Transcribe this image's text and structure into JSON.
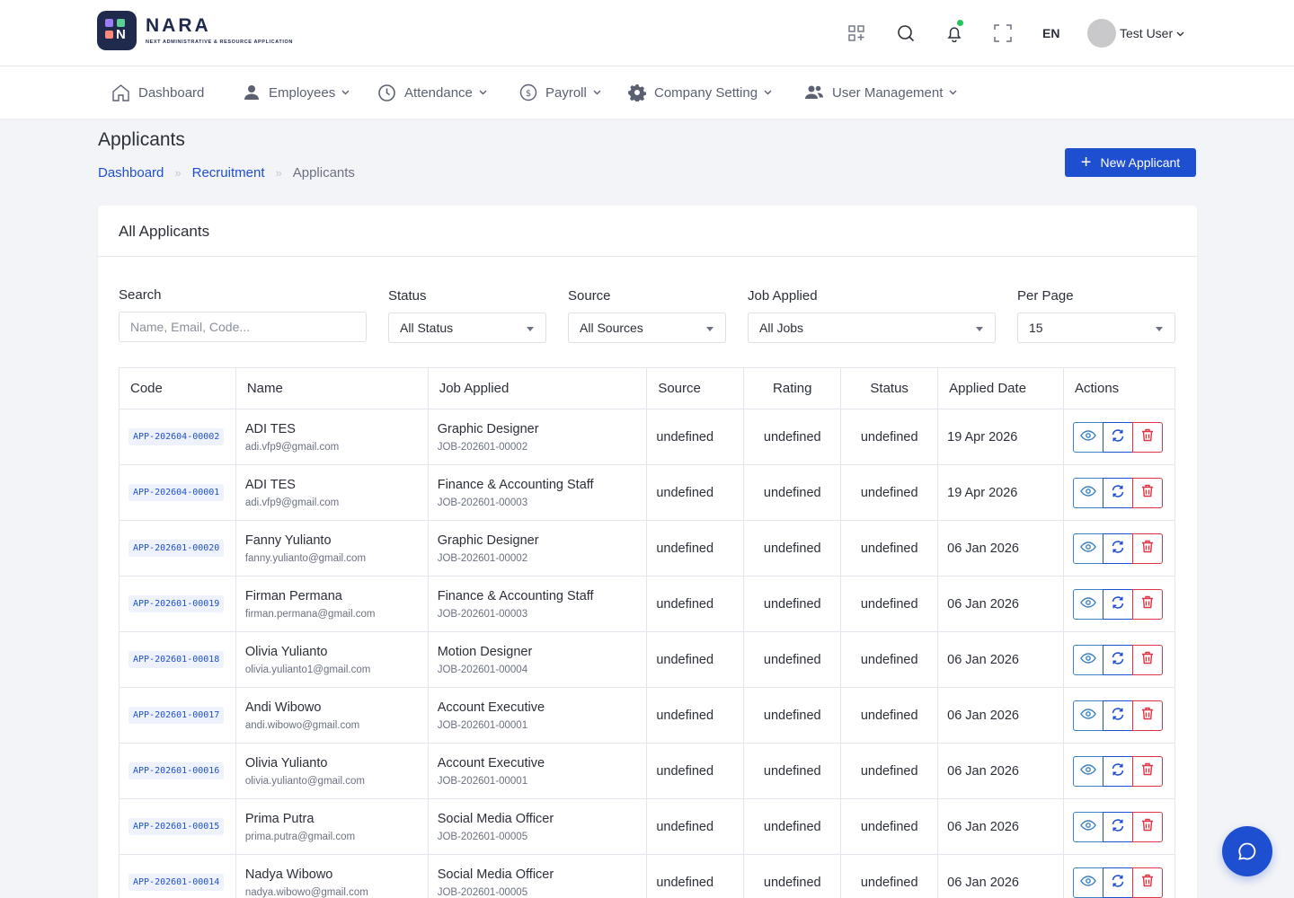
{
  "brand": {
    "name": "NARA",
    "tagline": "NEXT ADMINISTRATIVE & RESOURCE APPLICATION",
    "mark_letter": "N"
  },
  "header": {
    "language": "EN",
    "user_name": "Test User"
  },
  "nav": {
    "dashboard": "Dashboard",
    "employees": "Employees",
    "attendance": "Attendance",
    "payroll": "Payroll",
    "company_setting": "Company Setting",
    "user_management": "User Management"
  },
  "page": {
    "title": "Applicants",
    "breadcrumb": [
      "Dashboard",
      "Recruitment",
      "Applicants"
    ],
    "new_button": "New Applicant"
  },
  "card": {
    "title": "All Applicants",
    "filters": {
      "search_label": "Search",
      "search_placeholder": "Name, Email, Code...",
      "status_label": "Status",
      "status_value": "All Status",
      "source_label": "Source",
      "source_value": "All Sources",
      "job_label": "Job Applied",
      "job_value": "All Jobs",
      "perpage_label": "Per Page",
      "perpage_value": "15"
    },
    "columns": [
      "Code",
      "Name",
      "Job Applied",
      "Source",
      "Rating",
      "Status",
      "Applied Date",
      "Actions"
    ],
    "rows": [
      {
        "code": "APP-202604-00002",
        "name": "ADI TES",
        "email": "adi.vfp9@gmail.com",
        "job": "Graphic Designer",
        "job_code": "JOB-202601-00002",
        "source": "undefined",
        "rating": "undefined",
        "status": "undefined",
        "date": "19 Apr 2026"
      },
      {
        "code": "APP-202604-00001",
        "name": "ADI TES",
        "email": "adi.vfp9@gmail.com",
        "job": "Finance & Accounting Staff",
        "job_code": "JOB-202601-00003",
        "source": "undefined",
        "rating": "undefined",
        "status": "undefined",
        "date": "19 Apr 2026"
      },
      {
        "code": "APP-202601-00020",
        "name": "Fanny Yulianto",
        "email": "fanny.yulianto@gmail.com",
        "job": "Graphic Designer",
        "job_code": "JOB-202601-00002",
        "source": "undefined",
        "rating": "undefined",
        "status": "undefined",
        "date": "06 Jan 2026"
      },
      {
        "code": "APP-202601-00019",
        "name": "Firman Permana",
        "email": "firman.permana@gmail.com",
        "job": "Finance & Accounting Staff",
        "job_code": "JOB-202601-00003",
        "source": "undefined",
        "rating": "undefined",
        "status": "undefined",
        "date": "06 Jan 2026"
      },
      {
        "code": "APP-202601-00018",
        "name": "Olivia Yulianto",
        "email": "olivia.yulianto1@gmail.com",
        "job": "Motion Designer",
        "job_code": "JOB-202601-00004",
        "source": "undefined",
        "rating": "undefined",
        "status": "undefined",
        "date": "06 Jan 2026"
      },
      {
        "code": "APP-202601-00017",
        "name": "Andi Wibowo",
        "email": "andi.wibowo@gmail.com",
        "job": "Account Executive",
        "job_code": "JOB-202601-00001",
        "source": "undefined",
        "rating": "undefined",
        "status": "undefined",
        "date": "06 Jan 2026"
      },
      {
        "code": "APP-202601-00016",
        "name": "Olivia Yulianto",
        "email": "olivia.yulianto@gmail.com",
        "job": "Account Executive",
        "job_code": "JOB-202601-00001",
        "source": "undefined",
        "rating": "undefined",
        "status": "undefined",
        "date": "06 Jan 2026"
      },
      {
        "code": "APP-202601-00015",
        "name": "Prima Putra",
        "email": "prima.putra@gmail.com",
        "job": "Social Media Officer",
        "job_code": "JOB-202601-00005",
        "source": "undefined",
        "rating": "undefined",
        "status": "undefined",
        "date": "06 Jan 2026"
      },
      {
        "code": "APP-202601-00014",
        "name": "Nadya Wibowo",
        "email": "nadya.wibowo@gmail.com",
        "job": "Social Media Officer",
        "job_code": "JOB-202601-00005",
        "source": "undefined",
        "rating": "undefined",
        "status": "undefined",
        "date": "06 Jan 2026"
      }
    ]
  },
  "colors": {
    "primary": "#1f4fd1",
    "danger": "#dc3545",
    "info": "#3b82c4",
    "notif_dot": "#22c55e"
  }
}
